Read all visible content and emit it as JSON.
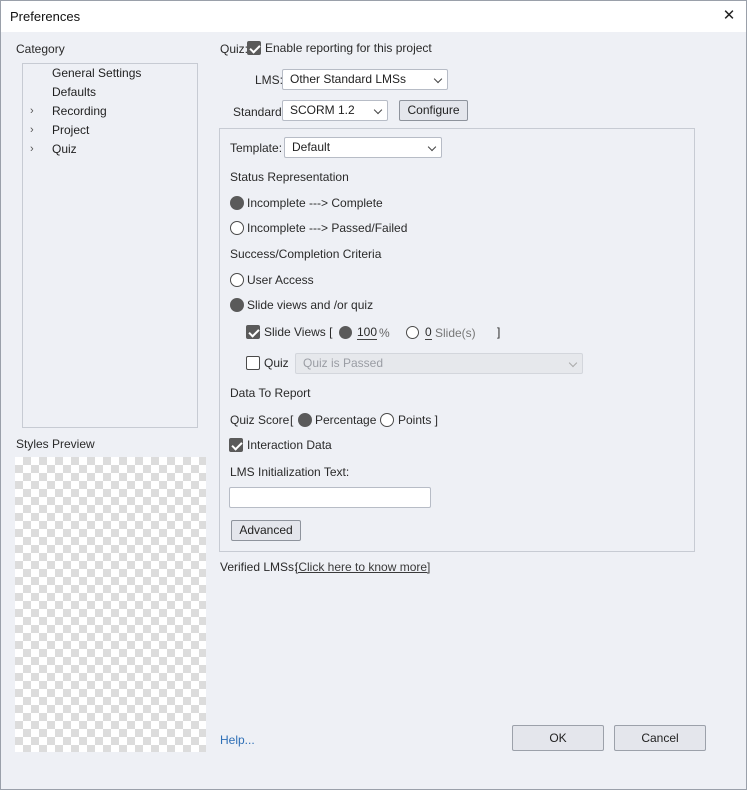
{
  "window": {
    "title": "Preferences",
    "close_glyph": "✕"
  },
  "category": {
    "heading": "Category",
    "items": [
      {
        "label": "General Settings",
        "expandable": false
      },
      {
        "label": "Defaults",
        "expandable": false
      },
      {
        "label": "Recording",
        "expandable": true
      },
      {
        "label": "Project",
        "expandable": true
      },
      {
        "label": "Quiz",
        "expandable": true
      }
    ],
    "arrow_glyph": "›",
    "styles_preview_label": "Styles Preview"
  },
  "quiz": {
    "label": "Quiz:",
    "enable_reporting_label": "Enable reporting for this project",
    "enable_reporting_checked": true,
    "lms_label": "LMS:",
    "lms_value": "Other Standard LMSs",
    "standard_label": "Standard:",
    "standard_value": "SCORM 1.2",
    "configure_label": "Configure",
    "template_label": "Template:",
    "template_value": "Default",
    "status_title": "Status Representation",
    "status_options": [
      "Incomplete ---> Complete",
      "Incomplete ---> Passed/Failed"
    ],
    "status_selected": 0,
    "success_title": "Success/Completion Criteria",
    "success_options": [
      "User Access",
      "Slide views and /or quiz"
    ],
    "success_selected": 1,
    "slide_views_label": "Slide Views [",
    "slide_views_checked": true,
    "percent_value": "100",
    "percent_unit": "%",
    "slides_value": "0",
    "slides_unit": "Slide(s)",
    "close_bracket": "]",
    "quiz_check_label": "Quiz",
    "quiz_checked": false,
    "quiz_select_value": "Quiz is Passed",
    "data_title": "Data To Report",
    "quiz_score_label": "Quiz Score",
    "open_bracket": "[",
    "percentage_label": "Percentage",
    "points_label": "Points ]",
    "interaction_label": "Interaction Data",
    "interaction_checked": true,
    "lms_init_label": "LMS Initialization Text:",
    "lms_init_value": "",
    "advanced_label": "Advanced",
    "verified_label": "Verified LMSs:",
    "verified_link": "[Click here to know more]"
  },
  "footer": {
    "help": "Help...",
    "ok": "OK",
    "cancel": "Cancel"
  }
}
